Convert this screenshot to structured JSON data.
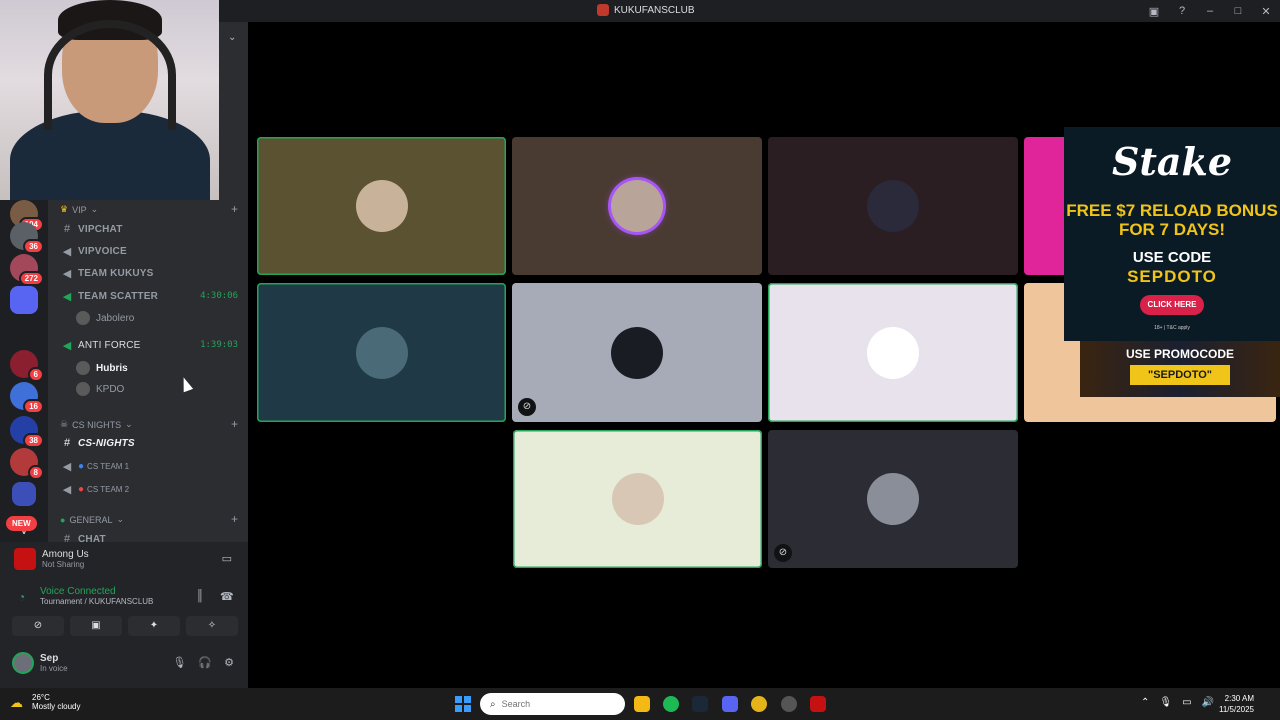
{
  "window": {
    "title": "KUKUFANSCLUB"
  },
  "titlebar_icons": [
    "screen-icon",
    "help-icon",
    "minimize-icon",
    "maximize-icon",
    "close-icon"
  ],
  "server_rail": {
    "badges": [
      "104",
      "36",
      "272",
      "6",
      "16",
      "38",
      "8"
    ],
    "letter": "V",
    "new_label": "NEW"
  },
  "channels": {
    "vip_category": "VIP",
    "vip_items": [
      {
        "name": "VIPCHAT",
        "type": "text"
      },
      {
        "name": "VIPVOICE",
        "type": "voice"
      },
      {
        "name": "TEAM KUKUYS",
        "type": "voice"
      },
      {
        "name": "TEAM SCATTER",
        "type": "voice",
        "timer": "4:30:06"
      }
    ],
    "scatter_user": "Jabolero",
    "anti_force": {
      "name": "ANTI FORCE",
      "timer": "1:39:03"
    },
    "anti_force_users": [
      "Hubris",
      "KPDO"
    ],
    "cs_category": "CS NIGHTS",
    "cs_items": [
      {
        "name": "CS-NIGHTS",
        "type": "text"
      },
      {
        "name": "CS TEAM 1",
        "type": "voice"
      },
      {
        "name": "CS TEAM 2",
        "type": "voice"
      }
    ],
    "general_category": "GENERAL",
    "general_first": "CHAT"
  },
  "panel": {
    "game_title": "Among Us",
    "game_status": "Not Sharing",
    "voice_title": "Voice Connected",
    "voice_channel": "Tournament / KUKUFANSCLUB",
    "user_name": "Sep",
    "user_status": "In voice"
  },
  "ad": {
    "brand": "Stake",
    "line1": "FREE $7 RELOAD BONUS FOR 7 DAYS!",
    "line2": "USE CODE",
    "code": "SEPDOTO",
    "button": "CLICK HERE",
    "fine": "18+ | T&C apply",
    "promo_title": "USE PROMOCODE",
    "promo_code": "\"SEPDOTO\""
  },
  "taskbar": {
    "temp": "26°C",
    "weather": "Mostly cloudy",
    "search_placeholder": "Search",
    "time": "2:30 AM",
    "date": "11/5/2025"
  },
  "colors": {
    "speaking": "#23a559",
    "tile_1": "#5a5230",
    "tile_2": "#4a3b32",
    "tile_3": "#2a1e22",
    "tile_4": "#1f3a46",
    "tile_5": "#a7abb8",
    "tile_6": "#e8e2ec",
    "tile_7": "#e7ecd9",
    "tile_8": "#2c2c34"
  }
}
